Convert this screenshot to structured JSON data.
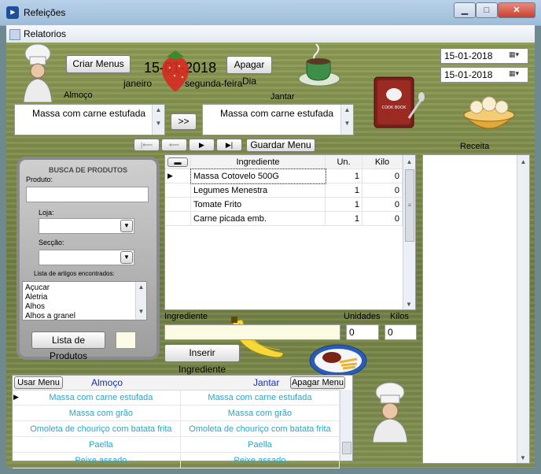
{
  "window": {
    "title": "Refeições",
    "minimize": "▁",
    "maximize": "□",
    "close": "✕"
  },
  "menu": {
    "item": "Relatorios"
  },
  "top": {
    "criar_menus": "Criar Menus",
    "apagar_dia": "Apagar Dia",
    "date_big": "15-01-2018",
    "month": "janeiro",
    "weekday": "segunda-feira",
    "almoco_label": "Almoço",
    "jantar_label": "Jantar",
    "almoco_text": "Massa com carne estufada",
    "jantar_text": "Massa com carne estufada",
    "copy_button": ">>",
    "date_picker_1": "15-01-2018",
    "date_picker_2": "15-01-2018",
    "receita_label": "Receita"
  },
  "nav": {
    "first": "|⟵",
    "prev": "⟵",
    "next": "▶",
    "last": "▶|",
    "save": "Guardar Menu"
  },
  "search": {
    "title": "BUSCA DE PRODUTOS",
    "produto_label": "Produto:",
    "loja_label": "Loja:",
    "seccao_label": "Secção:",
    "lista_label": "Lista de artigos encontrados:",
    "artigos": [
      "Açucar",
      "Aletria",
      "Alhos",
      "Alhos a granel"
    ],
    "lista_button": "Lista de Produtos"
  },
  "ingredients": {
    "collapse": "▬",
    "headers": {
      "ingrediente": "Ingrediente",
      "un": "Un.",
      "kilo": "Kilo"
    },
    "rows": [
      {
        "ingrediente": "Massa Cotovelo 500G",
        "un": "1",
        "kilo": "0"
      },
      {
        "ingrediente": "Legumes Menestra",
        "un": "1",
        "kilo": "0"
      },
      {
        "ingrediente": "Tomate Frito",
        "un": "1",
        "kilo": "0"
      },
      {
        "ingrediente": "Carne picada emb.",
        "un": "1",
        "kilo": "0"
      }
    ],
    "input_label": "Ingrediente",
    "unidades_label": "Unidades",
    "kilos_label": "Kilos",
    "unidades_value": "0",
    "kilos_value": "0",
    "insert_button": "Inserir Ingrediente"
  },
  "menus": {
    "usar_button": "Usar Menu",
    "apagar_button": "Apagar Menu",
    "col_almoco": "Almoço",
    "col_jantar": "Jantar",
    "rows": [
      {
        "almoco": "Massa com carne estufada",
        "jantar": "Massa com carne estufada"
      },
      {
        "almoco": "Massa com grão",
        "jantar": "Massa com grão"
      },
      {
        "almoco": "Omoleta de chouriço com batata frita",
        "jantar": "Omoleta de chouriço com batata frita"
      },
      {
        "almoco": "Paella",
        "jantar": "Paella"
      },
      {
        "almoco": "Peixe assado",
        "jantar": "Peixe assado"
      }
    ]
  },
  "icons": [
    "app-icon",
    "chef-icon",
    "strawberry-icon",
    "coffee-cup-icon",
    "cookbook-icon",
    "cookie-bowl-icon",
    "banana-icon",
    "plate-icon",
    "chef-small-icon"
  ]
}
